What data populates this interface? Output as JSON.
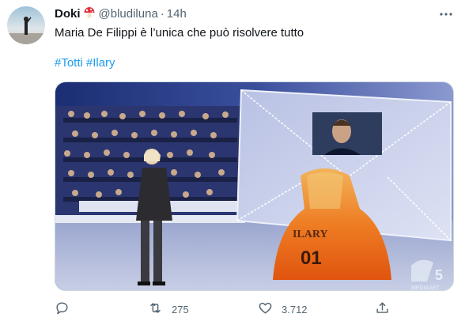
{
  "author": {
    "name": "Doki",
    "badge_icon": "mushroom-emoji",
    "handle": "@bludiluna",
    "separator": "·",
    "time": "14h"
  },
  "tweet": {
    "text": "Maria De Filippi è l’unica che può risolvere tutto",
    "hashtags": [
      "#Totti",
      "#Ilary"
    ]
  },
  "media": {
    "hoodie_text": "ILARY",
    "hoodie_number": "01",
    "watermark": "MEDIASET"
  },
  "actions": {
    "reply": {
      "icon": "reply-icon",
      "count": ""
    },
    "retweet": {
      "icon": "retweet-icon",
      "count": "275"
    },
    "like": {
      "icon": "heart-icon",
      "count": "3.712"
    },
    "share": {
      "icon": "share-icon",
      "count": ""
    }
  },
  "colors": {
    "link": "#1d9bf0",
    "secondary_text": "#536471",
    "primary_text": "#0f1419"
  }
}
